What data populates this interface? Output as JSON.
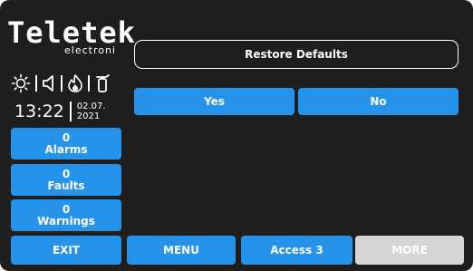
{
  "brand": {
    "name": "Teletek",
    "sub": "electroni"
  },
  "status_icons": [
    "sun-icon",
    "speaker-icon",
    "fire-icon",
    "extinguisher-icon"
  ],
  "clock": {
    "time": "13:22",
    "date_day_month": "02.07.",
    "date_year": "2021"
  },
  "counters": [
    {
      "count": "0",
      "label": "Alarms"
    },
    {
      "count": "0",
      "label": "Faults"
    },
    {
      "count": "0",
      "label": "Warnings"
    }
  ],
  "dialog": {
    "title": "Restore Defaults",
    "yes_label": "Yes",
    "no_label": "No"
  },
  "bottom_bar": {
    "exit": "EXIT",
    "menu": "MENU",
    "access": "Access 3",
    "more": "MORE"
  },
  "colors": {
    "background": "#1e1e1e",
    "accent": "#2593ea",
    "disabled": "#d5d5d5"
  }
}
